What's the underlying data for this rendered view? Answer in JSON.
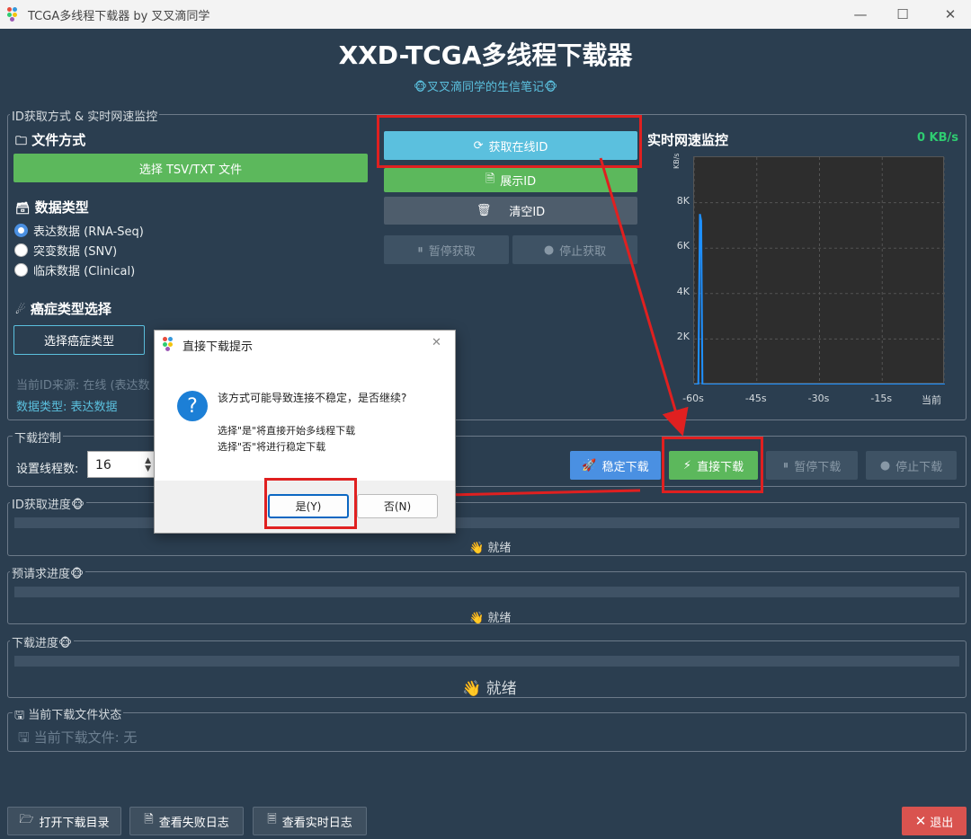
{
  "window": {
    "title": "TCGA多线程下载器 by 叉叉滴同学",
    "minimize": "—",
    "maximize": "☐",
    "close": "✕"
  },
  "header": {
    "title": "XXD-TCGA多线程下载器",
    "subtitle": "🐵叉叉滴同学的生信笔记🐵"
  },
  "id_group": {
    "label": "ID获取方式 & 实时网速监控",
    "file_section": "文件方式",
    "file_section_icon": "🗀",
    "select_file_btn": "选择 TSV/TXT 文件",
    "data_type_section": "数据类型",
    "data_type_icon": "🗃",
    "radios": [
      {
        "label": "表达数据 (RNA-Seq)",
        "checked": true
      },
      {
        "label": "突变数据 (SNV)",
        "checked": false
      },
      {
        "label": "临床数据 (Clinical)",
        "checked": false
      }
    ],
    "cancer_section": "癌症类型选择",
    "cancer_icon": "☄",
    "select_cancer_btn": "选择癌症类型",
    "current_source": "当前ID来源: 在线 (表达数",
    "data_type_info": "数据类型: 表达数据",
    "fetch_online_btn": "获取在线ID",
    "fetch_icon": "⟳",
    "show_id_btn": "展示ID",
    "show_icon": "🗎",
    "clear_id_btn": "清空ID",
    "clear_icon": "🗑",
    "pause_fetch_btn": "暂停获取",
    "stop_fetch_btn": "停止获取"
  },
  "monitor": {
    "title": "实时网速监控",
    "speed": "0 KB/s",
    "y_unit": "KB/s",
    "accent": "#2ecc71"
  },
  "chart_data": {
    "type": "line",
    "title": "",
    "ylabel": "KB/s",
    "x_ticks": [
      "-60s",
      "-45s",
      "-30s",
      "-15s",
      "当前"
    ],
    "y_ticks": [
      "2K",
      "4K",
      "6K",
      "8K"
    ],
    "xlim": [
      -60,
      0
    ],
    "ylim": [
      0,
      10000
    ],
    "grid": true,
    "series": [
      {
        "x": [
          -60,
          -59.5,
          -59,
          -58.6,
          -58.3,
          -58,
          -57.5,
          -55,
          -50,
          -40,
          -30,
          -20,
          -10,
          0
        ],
        "values": [
          0,
          0,
          0,
          7500,
          7200,
          0,
          0,
          0,
          0,
          0,
          0,
          0,
          0,
          0
        ],
        "color": "#1e90ff"
      }
    ]
  },
  "download_group": {
    "label": "下载控制",
    "threads_label": "设置线程数:",
    "threads_value": "16",
    "stable_btn": "稳定下载",
    "stable_icon": "🚀",
    "direct_btn": "直接下载",
    "direct_icon": "⚡",
    "pause_btn": "暂停下载",
    "stop_btn": "停止下载"
  },
  "progress": [
    {
      "label": "ID获取进度",
      "icon": "🐵",
      "status": "就绪",
      "status_icon": "👋",
      "value": 0
    },
    {
      "label": "预请求进度",
      "icon": "🐵",
      "status": "就绪",
      "status_icon": "👋",
      "value": 0
    },
    {
      "label": "下载进度",
      "icon": "🐵",
      "status": "就绪",
      "status_icon": "👋",
      "value": 0
    }
  ],
  "current_file": {
    "label": "当前下载文件状态",
    "icon": "🖫",
    "text": "当前下载文件: 无"
  },
  "bottom": {
    "open_dir": "打开下载目录",
    "open_dir_icon": "🗁",
    "fail_log": "查看失败日志",
    "fail_log_icon": "🗎",
    "live_log": "查看实时日志",
    "live_log_icon": "🗏",
    "exit": "退出",
    "exit_icon": "✕"
  },
  "dialog": {
    "title": "直接下载提示",
    "close": "✕",
    "icon": "?",
    "message": "该方式可能导致连接不稳定，是否继续?",
    "line1": "选择\"是\"将直接开始多线程下载",
    "line2": "选择\"否\"将进行稳定下载",
    "yes": "是(Y)",
    "no": "否(N)"
  }
}
